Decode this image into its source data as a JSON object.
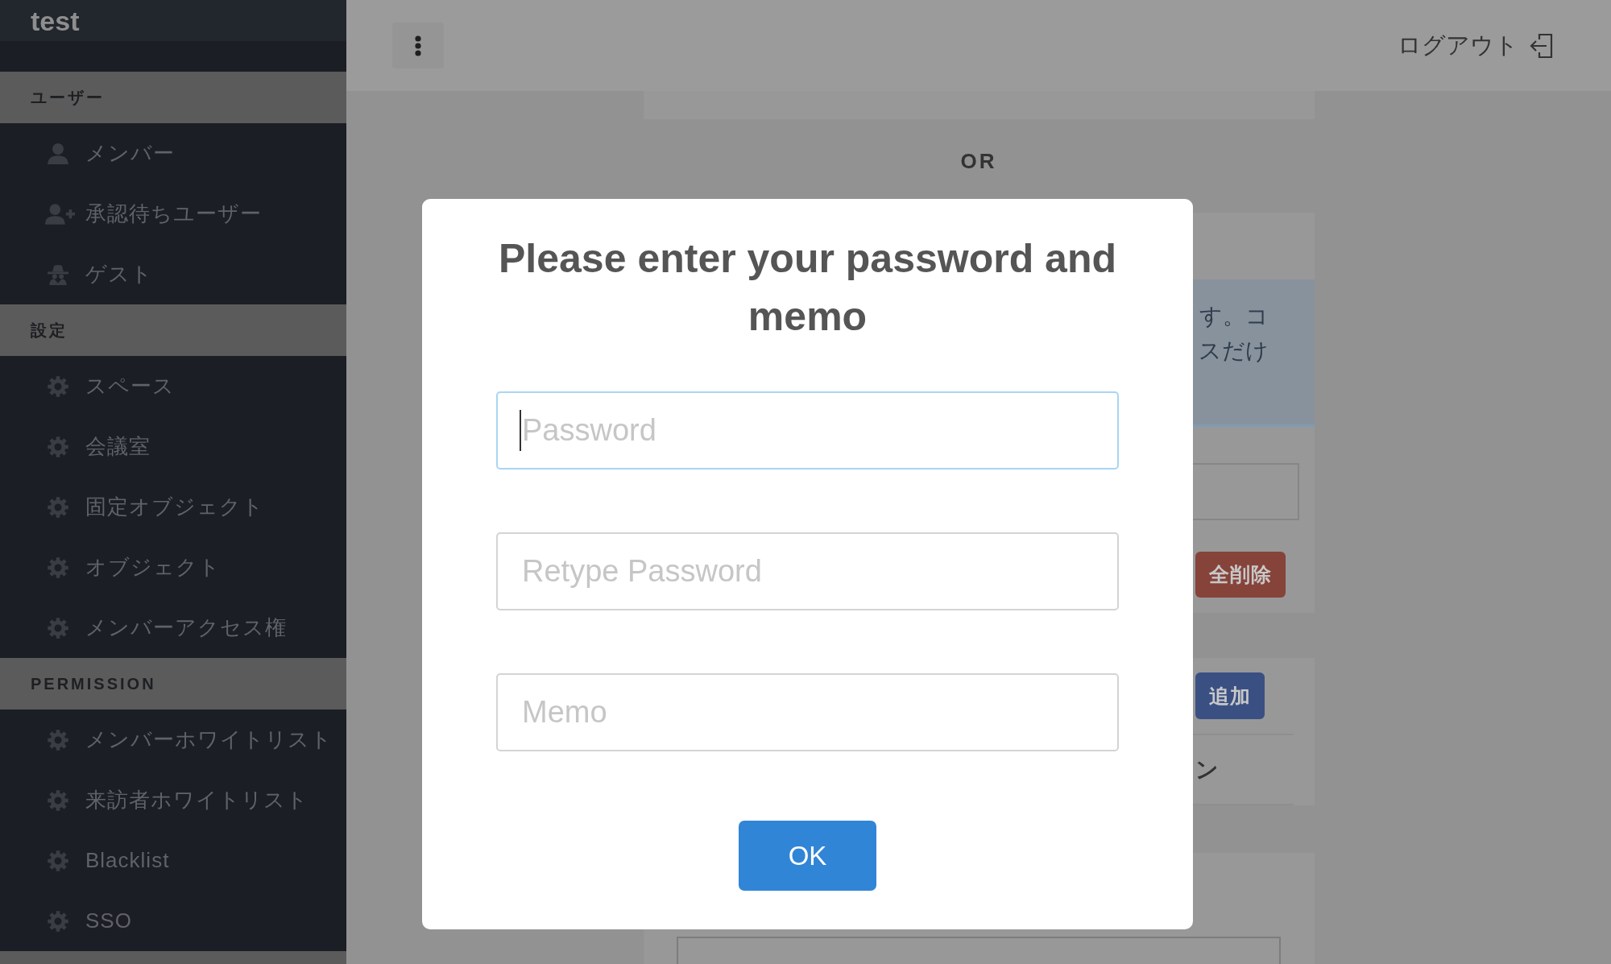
{
  "sidebar": {
    "title": "test",
    "sections": [
      {
        "heading": "ユーザー",
        "items": [
          {
            "label": "メンバー",
            "kind": "member"
          },
          {
            "label": "承認待ちユーザー",
            "kind": "applicant"
          },
          {
            "label": "ゲスト",
            "kind": "guest"
          }
        ]
      },
      {
        "heading": "設定",
        "items": [
          {
            "label": "スペース",
            "kind": "setting"
          },
          {
            "label": "会議室",
            "kind": "setting"
          },
          {
            "label": "固定オブジェクト",
            "kind": "setting"
          },
          {
            "label": "オブジェクト",
            "kind": "setting"
          },
          {
            "label": "メンバーアクセス権",
            "kind": "setting"
          }
        ]
      },
      {
        "heading": "PERMISSION",
        "items": [
          {
            "label": "メンバーホワイトリスト",
            "kind": "setting"
          },
          {
            "label": "来訪者ホワイトリスト",
            "kind": "setting"
          },
          {
            "label": "Blacklist",
            "kind": "setting"
          },
          {
            "label": "SSO",
            "kind": "setting"
          }
        ]
      }
    ]
  },
  "top_bar": {
    "logout_label": "ログアウト"
  },
  "page": {
    "separator_text": "OR",
    "notice_lines": [
      "す。コ",
      "スだけ"
    ],
    "delete_all_button": "全削除",
    "add_button": "追加",
    "heading_fragment": "ン"
  },
  "dialog": {
    "title": "Please enter your password and memo",
    "fields": [
      {
        "placeholder": "Password",
        "focused": true
      },
      {
        "placeholder": "Retype Password",
        "focused": false
      },
      {
        "placeholder": "Memo",
        "focused": false
      }
    ],
    "ok_button": "OK"
  }
}
